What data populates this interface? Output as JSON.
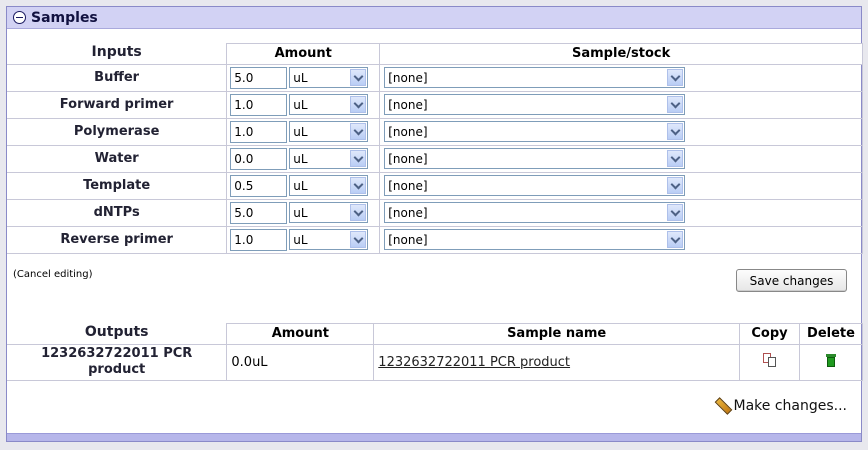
{
  "panel": {
    "title": "Samples"
  },
  "inputs": {
    "section_label": "Inputs",
    "col_amount": "Amount",
    "col_stock": "Sample/stock",
    "rows": [
      {
        "label": "Buffer",
        "amount": "5.0",
        "unit": "uL",
        "stock": "[none]"
      },
      {
        "label": "Forward primer",
        "amount": "1.0",
        "unit": "uL",
        "stock": "[none]"
      },
      {
        "label": "Polymerase",
        "amount": "1.0",
        "unit": "uL",
        "stock": "[none]"
      },
      {
        "label": "Water",
        "amount": "0.0",
        "unit": "uL",
        "stock": "[none]"
      },
      {
        "label": "Template",
        "amount": "0.5",
        "unit": "uL",
        "stock": "[none]"
      },
      {
        "label": "dNTPs",
        "amount": "5.0",
        "unit": "uL",
        "stock": "[none]"
      },
      {
        "label": "Reverse primer",
        "amount": "1.0",
        "unit": "uL",
        "stock": "[none]"
      }
    ]
  },
  "actions": {
    "cancel_label": "(Cancel editing)",
    "save_label": "Save changes",
    "make_changes_label": "Make changes..."
  },
  "outputs": {
    "section_label": "Outputs",
    "col_amount": "Amount",
    "col_name": "Sample name",
    "col_copy": "Copy",
    "col_delete": "Delete",
    "rows": [
      {
        "label_line1": "1232632722011 PCR",
        "label_line2": "product",
        "amount": "0.0uL",
        "name": "1232632722011 PCR product"
      }
    ]
  }
}
